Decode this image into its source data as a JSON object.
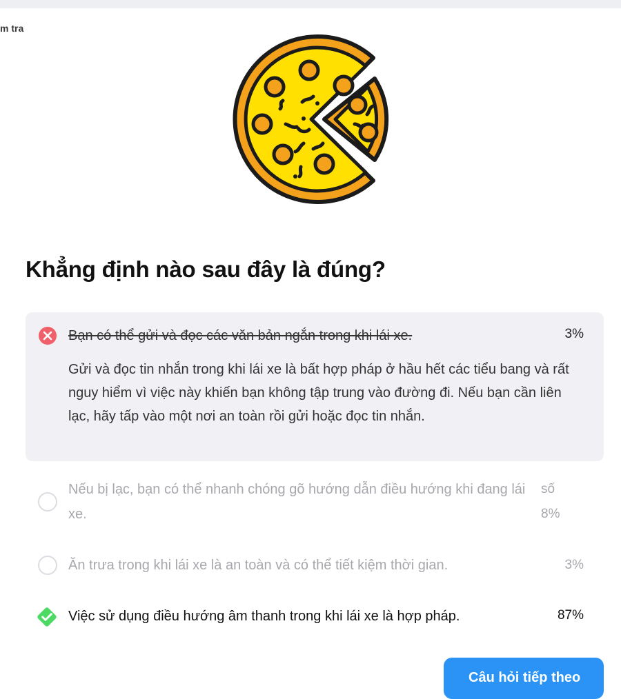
{
  "breadcrumb": "m tra",
  "question": "Khẳng định nào sau đây là đúng?",
  "answers": [
    {
      "text": "Bạn có thể gửi và đọc các văn bản ngắn trong khi lái xe.",
      "percent": "3%",
      "state": "incorrect-selected",
      "explanation": "Gửi và đọc tin nhắn trong khi lái xe là bất hợp pháp ở hầu hết các tiểu bang và rất nguy hiểm vì việc này khiến bạn không tập trung vào đường đi. Nếu bạn cần liên lạc, hãy tấp vào một nơi an toàn rồi gửi hoặc đọc tin nhắn."
    },
    {
      "text": "Nếu bị lạc, bạn có thể nhanh chóng gõ hướng dẫn điều hướng khi đang lái xe.",
      "percent": "số 8%",
      "state": "unselected"
    },
    {
      "text": "Ăn trưa trong khi lái xe là an toàn và có thể tiết kiệm thời gian.",
      "percent": "3%",
      "state": "unselected"
    },
    {
      "text": "Việc sử dụng điều hướng âm thanh trong khi lái xe là hợp pháp.",
      "percent": "87%",
      "state": "correct"
    }
  ],
  "continue_button": "Câu hỏi tiếp theo",
  "icons": {
    "hero": "pizza-slice-icon",
    "wrong": "x-circle-icon",
    "correct": "check-diamond-icon",
    "radio": "radio-empty-icon"
  },
  "colors": {
    "accent": "#2b93f5",
    "wrong": "#f0606a",
    "correct": "#4cd964",
    "pizza_crust": "#f4a21b",
    "pizza_cheese": "#ffe000"
  }
}
